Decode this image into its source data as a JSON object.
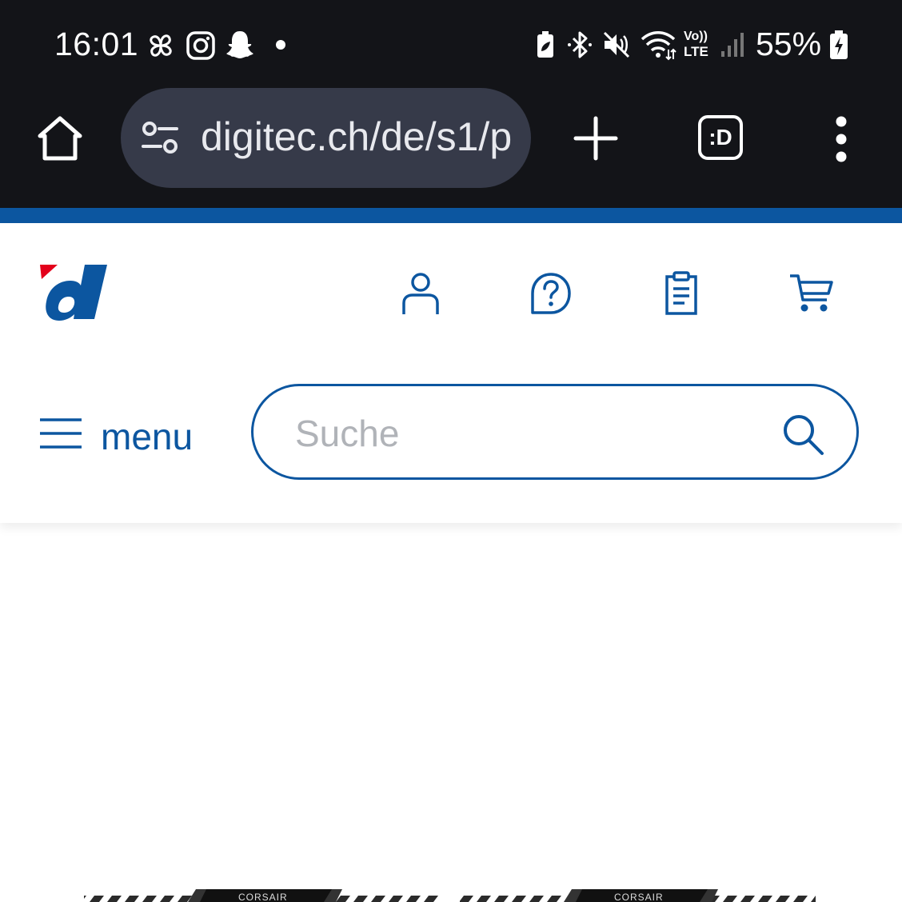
{
  "status_bar": {
    "time": "16:01",
    "battery_percent": "55%",
    "network_label": "LTE",
    "volte_label": "Vo))",
    "left_icons": [
      "pinwheel-icon",
      "instagram-icon",
      "snapchat-icon",
      "notification-dot"
    ],
    "right_icons": [
      "battery-saver-icon",
      "bluetooth-icon",
      "mute-icon",
      "wifi-icon",
      "volte-lte-icon",
      "signal-icon",
      "battery-charging-icon"
    ]
  },
  "browser": {
    "url": "digitec.ch/de/s1/p",
    "tab_badge": ":D",
    "icons": [
      "home-icon",
      "site-settings-icon",
      "new-tab-icon",
      "tab-switcher-icon",
      "more-menu-icon"
    ]
  },
  "site": {
    "logo_letter": "d",
    "header_icons": [
      "account-icon",
      "help-icon",
      "order-list-icon",
      "cart-icon"
    ],
    "menu_label": "menu",
    "search_placeholder": "Suche",
    "product_brand": "CORSAIR"
  },
  "colors": {
    "brand_blue": "#0c56a0",
    "brand_red": "#e3001b",
    "chrome_dark": "#131418",
    "urlbar_bg": "#363a49"
  }
}
